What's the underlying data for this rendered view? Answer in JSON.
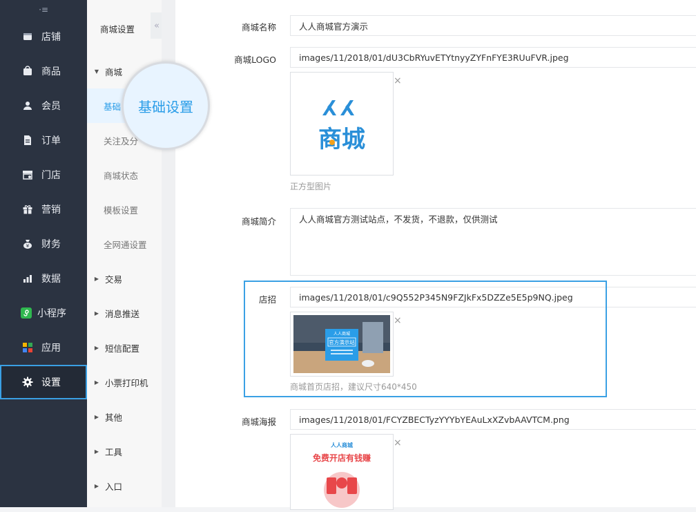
{
  "sidebar": {
    "collapse_icon": "·≡",
    "items": [
      {
        "label": "店铺",
        "icon": "store-icon"
      },
      {
        "label": "商品",
        "icon": "bag-icon"
      },
      {
        "label": "会员",
        "icon": "user-icon"
      },
      {
        "label": "订单",
        "icon": "document-icon"
      },
      {
        "label": "门店",
        "icon": "shop-icon"
      },
      {
        "label": "营销",
        "icon": "gift-icon"
      },
      {
        "label": "财务",
        "icon": "money-bag-icon"
      },
      {
        "label": "数据",
        "icon": "bar-chart-icon"
      },
      {
        "label": "小程序",
        "icon": "mini-program-icon"
      },
      {
        "label": "应用",
        "icon": "apps-icon"
      },
      {
        "label": "设置",
        "icon": "gear-icon",
        "active": true
      }
    ]
  },
  "submenu": {
    "title": "商城设置",
    "collapse_icon": "«",
    "groups": [
      {
        "label": "商城",
        "expanded": true
      },
      {
        "label": "基础",
        "child": true,
        "selected": true
      },
      {
        "label": "关注及分",
        "child": true
      },
      {
        "label": "商城状态",
        "child": true
      },
      {
        "label": "模板设置",
        "child": true
      },
      {
        "label": "全网通设置",
        "child": true
      },
      {
        "label": "交易"
      },
      {
        "label": "消息推送"
      },
      {
        "label": "短信配置"
      },
      {
        "label": "小票打印机"
      },
      {
        "label": "其他"
      },
      {
        "label": "工具"
      },
      {
        "label": "入口"
      }
    ]
  },
  "magnifier": {
    "text": "基础设置"
  },
  "form": {
    "name": {
      "label": "商城名称",
      "value": "人人商城官方演示"
    },
    "logo": {
      "label": "商城LOGO",
      "value": "images/11/2018/01/dU3CbRYuvETYtnyyZYFnFYE3RUuFVR.jpeg",
      "logo_line1": "人人",
      "logo_line2": "商城",
      "hint": "正方型图片",
      "remove": "×"
    },
    "intro": {
      "label": "商城简介",
      "value": "人人商城官方测试站点，不发货，不退款，仅供测试"
    },
    "sign": {
      "label": "店招",
      "value": "images/11/2018/01/c9Q552P345N9FZJkFx5DZZe5E5p9NQ.jpeg",
      "banner_brand": "人人商城",
      "banner_title": "官方演示站",
      "hint": "商城首页店招，建议尺寸640*450",
      "remove": "×"
    },
    "poster": {
      "label": "商城海报",
      "value": "images/11/2018/01/FCYZBECTyzYYYbYEAuLxXZvbAAVTCM.png",
      "poster_brand": "人人商城",
      "poster_title": "免费开店有钱赚",
      "remove": "×"
    }
  },
  "colors": {
    "accent": "#3aa0e4",
    "brand_blue": "#2a8fd8",
    "sidebar_bg": "#2b3341",
    "poster_red": "#e8474a"
  }
}
